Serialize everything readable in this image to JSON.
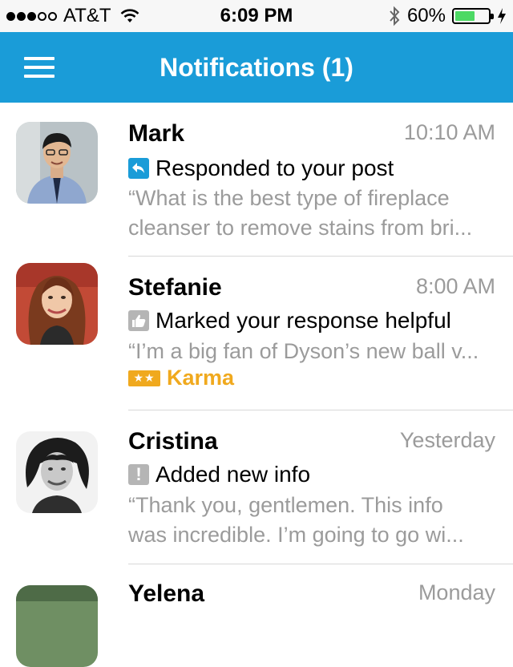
{
  "status_bar": {
    "carrier": "AT&T",
    "time": "6:09 PM",
    "battery_percent": "60%",
    "battery_level": 0.6,
    "signal_bars_filled": 3,
    "signal_bars_total": 5
  },
  "nav": {
    "title": "Notifications (1)"
  },
  "notifications": [
    {
      "name": "Mark",
      "time": "10:10 AM",
      "action": "Responded to your post",
      "action_icon": "reply-icon",
      "action_color": "#1a9cd8",
      "quote_lines": [
        "“What is the best type of fireplace",
        "cleanser to remove stains from bri..."
      ]
    },
    {
      "name": "Stefanie",
      "time": "8:00 AM",
      "action": "Marked your response helpful",
      "action_icon": "thumbs-up-icon",
      "action_color": "#b5b5b5",
      "quote_lines": [
        "“I’m a big fan of Dyson’s new ball v..."
      ],
      "karma": "Karma"
    },
    {
      "name": "Cristina",
      "time": "Yesterday",
      "action": "Added new info",
      "action_icon": "exclamation-icon",
      "action_color": "#b5b5b5",
      "quote_lines": [
        "“Thank you, gentlemen. This info",
        "was incredible. I’m going to go wi..."
      ]
    },
    {
      "name": "Yelena",
      "time": "Monday"
    }
  ],
  "colors": {
    "nav_blue": "#1a9cd8",
    "karma_orange": "#f0a91e",
    "secondary_text": "#9b9b9b"
  }
}
